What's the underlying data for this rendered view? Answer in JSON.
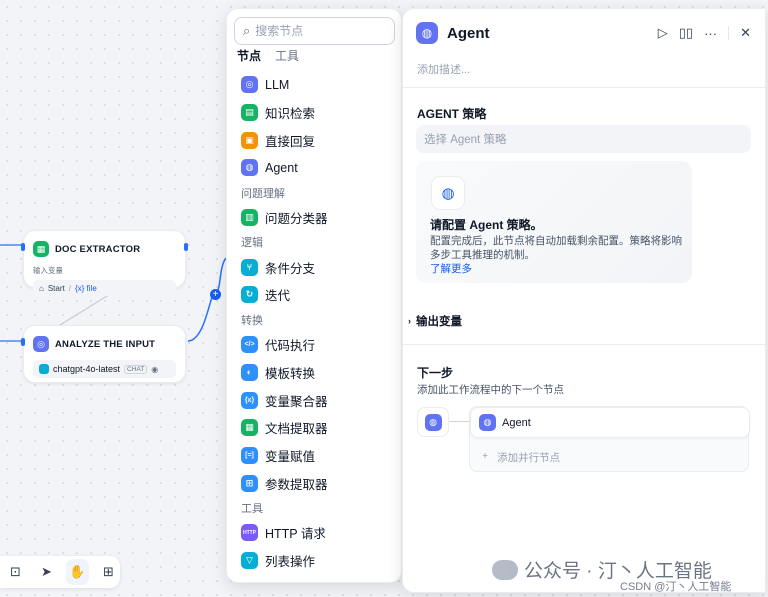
{
  "canvas": {
    "nodes": [
      {
        "title": "DOC EXTRACTOR",
        "sub": "输入变量",
        "chip_a": "Start",
        "chip_sep": "/",
        "chip_b": "{x} file"
      },
      {
        "title": "ANALYZE THE INPUT",
        "model": "chatgpt-4o-latest",
        "badge": "CHAT"
      }
    ]
  },
  "toolbar": {
    "icons": [
      "add-block-icon",
      "pointer-icon",
      "hand-icon",
      "organize-icon"
    ]
  },
  "picker": {
    "search_placeholder": "搜索节点",
    "tabs": [
      "节点",
      "工具"
    ],
    "items": [
      {
        "label": "LLM",
        "color": "#6172f3",
        "glyph": "◎"
      },
      {
        "label": "知识检索",
        "color": "#16b364",
        "glyph": "▤"
      },
      {
        "label": "直接回复",
        "color": "#f79009",
        "glyph": "▣"
      },
      {
        "label": "Agent",
        "color": "#6172f3",
        "glyph": "◍"
      }
    ],
    "group1": "问题理解",
    "items1": [
      {
        "label": "问题分类器",
        "color": "#16b364",
        "glyph": "▥"
      }
    ],
    "group2": "逻辑",
    "items2": [
      {
        "label": "条件分支",
        "color": "#06aed4",
        "glyph": "⑂"
      },
      {
        "label": "迭代",
        "color": "#06aed4",
        "glyph": "↻"
      }
    ],
    "group3": "转换",
    "items3": [
      {
        "label": "代码执行",
        "color": "#2e90fa",
        "glyph": "</>"
      },
      {
        "label": "模板转换",
        "color": "#2e90fa",
        "glyph": "◐"
      },
      {
        "label": "变量聚合器",
        "color": "#2e90fa",
        "glyph": "{x}"
      },
      {
        "label": "文档提取器",
        "color": "#16b364",
        "glyph": "▦"
      },
      {
        "label": "变量赋值",
        "color": "#2e90fa",
        "glyph": "[=]"
      },
      {
        "label": "参数提取器",
        "color": "#2e90fa",
        "glyph": "⊞"
      }
    ],
    "group4": "工具",
    "items4": [
      {
        "label": "HTTP 请求",
        "color": "#7a5af8",
        "glyph": "HTTP"
      },
      {
        "label": "列表操作",
        "color": "#06aed4",
        "glyph": "▽"
      }
    ]
  },
  "panel": {
    "title": "Agent",
    "description_placeholder": "添加描述...",
    "strategy_label": "AGENT 策略",
    "strategy_placeholder": "选择 Agent 策略",
    "card_title": "请配置 Agent 策略。",
    "card_body": "配置完成后，此节点将自动加载剩余配置。策略将影响多步工具推理的机制。",
    "card_link": "了解更多",
    "output_vars": "输出变量",
    "next_title": "下一步",
    "next_sub": "添加此工作流程中的下一个节点",
    "next_node": "Agent",
    "add_parallel": "添加并行节点"
  },
  "watermark": {
    "main": "公众号 · 汀丶人工智能",
    "sub": "CSDN @汀丶人工智能"
  }
}
